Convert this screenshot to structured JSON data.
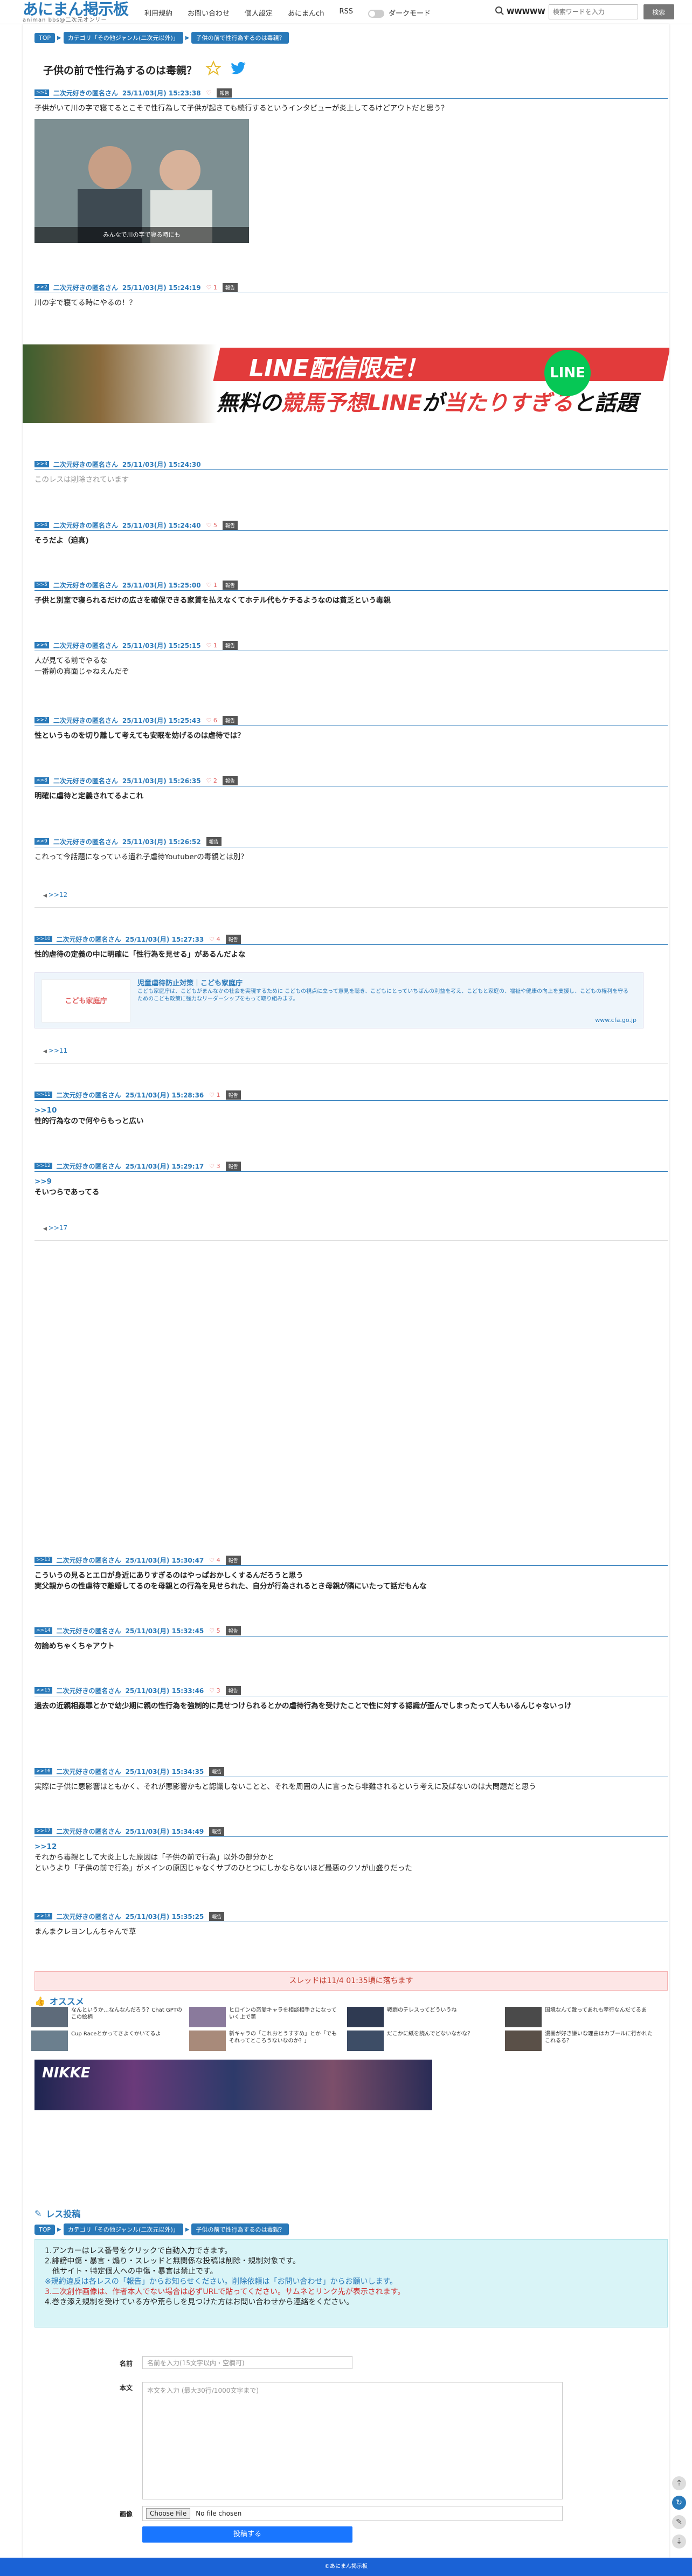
{
  "site": {
    "title": "あにまん掲示板",
    "subtitle": "animan bbs@二次元オンリー"
  },
  "nav": {
    "items": [
      "利用規約",
      "お問い合わせ",
      "個人設定",
      "あにまんch",
      "RSS"
    ],
    "dark_mode": "ダークモード"
  },
  "search": {
    "label": "WWWWW",
    "placeholder": "検索ワードを入力",
    "button": "検索"
  },
  "breadcrumb": [
    "TOP",
    "カテゴリ「その他ジャンル(二次元以外)」",
    "子供の前で性行為するのは毒親？"
  ],
  "thread": {
    "title": "子供の前で性行為するのは毒親？"
  },
  "banner": {
    "line1": "LINE配信限定！",
    "line2a": "無料の",
    "line2b": "競馬予想LINE",
    "line2c": "が",
    "line2d": "当たりすぎる",
    "line2e": "と話題に！",
    "line_icon": "LINE"
  },
  "posts": [
    {
      "no": "1",
      "name": "二次元好きの匿名さん",
      "date": "25/11/03(月) 15:23:38",
      "likes": "",
      "report": "報告",
      "body": "子供がいて川の字で寝てるとこそで性行為して子供が起きても続行するというインタビューが炎上してるけどアウトだと思う？",
      "thumb_caption": "みんなで川の字で寝る時にも"
    },
    {
      "no": "2",
      "name": "二次元好きの匿名さん",
      "date": "25/11/03(月) 15:24:19",
      "likes": "1",
      "report": "報告",
      "body": "川の字で寝てる時にやるの！？"
    },
    {
      "no": "3",
      "name": "二次元好きの匿名さん",
      "date": "25/11/03(月) 15:24:30",
      "likes": "",
      "report": "",
      "body": "このレスは削除されています"
    },
    {
      "no": "4",
      "name": "二次元好きの匿名さん",
      "date": "25/11/03(月) 15:24:40",
      "likes": "5",
      "report": "報告",
      "body": "そうだよ（迫真)"
    },
    {
      "no": "5",
      "name": "二次元好きの匿名さん",
      "date": "25/11/03(月) 15:25:00",
      "likes": "1",
      "report": "報告",
      "body": "子供と別室で寝られるだけの広さを確保できる家賃を払えなくてホテル代もケチるようなのは貧乏という毒親"
    },
    {
      "no": "6",
      "name": "二次元好きの匿名さん",
      "date": "25/11/03(月) 15:25:15",
      "likes": "1",
      "report": "報告",
      "body": "人が見てる前でやるな\n一番前の真面じゃねえんだぞ"
    },
    {
      "no": "7",
      "name": "二次元好きの匿名さん",
      "date": "25/11/03(月) 15:25:43",
      "likes": "6",
      "report": "報告",
      "body": "性というものを切り離して考えても安眠を妨げるのは虐待では？"
    },
    {
      "no": "8",
      "name": "二次元好きの匿名さん",
      "date": "25/11/03(月) 15:26:35",
      "likes": "2",
      "report": "報告",
      "body": "明確に虐待と定義されてるよこれ"
    },
    {
      "no": "9",
      "name": "二次元好きの匿名さん",
      "date": "25/11/03(月) 15:26:52",
      "likes": "",
      "report": "報告",
      "body": "これって今話題になっている遺れ子虐待Youtuberの毒親とは別？",
      "replies": ">>12"
    },
    {
      "no": "10",
      "name": "二次元好きの匿名さん",
      "date": "25/11/03(月) 15:27:33",
      "likes": "4",
      "report": "報告",
      "body": "性的虐待の定義の中に明確に「性行為を見せる」があるんだよな",
      "replies": ">>11"
    },
    {
      "no": "11",
      "name": "二次元好きの匿名さん",
      "date": "25/11/03(月) 15:28:36",
      "likes": "1",
      "report": "報告",
      "ref": ">>10",
      "body": "性的行為なので何やらもっと広い"
    },
    {
      "no": "12",
      "name": "二次元好きの匿名さん",
      "date": "25/11/03(月) 15:29:17",
      "likes": "3",
      "report": "報告",
      "ref": ">>9",
      "body": "そいつらであってる",
      "replies": ">>17"
    },
    {
      "no": "13",
      "name": "二次元好きの匿名さん",
      "date": "25/11/03(月) 15:30:47",
      "likes": "4",
      "report": "報告",
      "body": "こういうの見るとエロが身近にありすぎるのはやっぱおかしくするんだろうと思う\n実父親からの性虐待で離婚してるのを母親との行為を見せられた、自分が行為されるとき母親が隣にいたって話だもんな"
    },
    {
      "no": "14",
      "name": "二次元好きの匿名さん",
      "date": "25/11/03(月) 15:32:45",
      "likes": "5",
      "report": "報告",
      "body": "勿論めちゃくちゃアウト"
    },
    {
      "no": "15",
      "name": "二次元好きの匿名さん",
      "date": "25/11/03(月) 15:33:46",
      "likes": "3",
      "report": "報告",
      "body": "過去の近親相姦罪とかで幼少期に親の性行為を強制的に見せつけられるとかの虐待行為を受けたことで性に対する認識が歪んでしまったって人もいるんじゃないっけ"
    },
    {
      "no": "16",
      "name": "二次元好きの匿名さん",
      "date": "25/11/03(月) 15:34:35",
      "likes": "",
      "report": "報告",
      "body": "実際に子供に悪影響はともかく、それが悪影響かもと認識しないことと、それを周囲の人に言ったら非難されるという考えに及ばないのは大問題だと思う"
    },
    {
      "no": "17",
      "name": "二次元好きの匿名さん",
      "date": "25/11/03(月) 15:34:49",
      "likes": "",
      "report": "報告",
      "ref": ">>12",
      "body": "それから毒親として大炎上した原因は「子供の前で行為」以外の部分かと\nというより「子供の前で行為」がメインの原因じゃなくサブのひとつにしかならないほど最悪のクソが山盛りだった"
    },
    {
      "no": "18",
      "name": "二次元好きの匿名さん",
      "date": "25/11/03(月) 15:35:25",
      "likes": "",
      "report": "報告",
      "body": "まんまクレヨンしんちゃんで草"
    }
  ],
  "embed": {
    "logo": "こども家庭庁",
    "title": "児童虐待防止対策｜こども家庭庁",
    "desc": "こども家庭庁は、こどもがまんなかの社会を実現するために こどもの視点に立って意見を聴き、こどもにとっていちばんの利益を考え、こどもと家庭の、福祉や健康の向上を支援し、こどもの権利を守るためのこども政策に強力なリーダーシップをもって取り組みます。",
    "url": "www.cfa.go.jp"
  },
  "closed": "スレッドは11/4 01:35頃に落ちます",
  "osusume": {
    "title": "オススメ",
    "items": [
      "なんというか…なんなんだろう？Chat GPTのこの絵柄",
      "ヒロインの恋愛キャラを相談相手さになっていく上で第",
      "戦闘のテレスってどういうね",
      "国境なんて敵ってあれも孝行なんだてるあ",
      "Cup Raceとかってさよくかいてるよ",
      "新キャラの「これおとうすすめ」とか「でもそれってところうないなのか？」",
      "だこかに紙を読んでどないなかな？",
      "漫画が好き嫌いな理由はカブールに行かれたこれるる？"
    ],
    "ad": "NIKKE"
  },
  "form": {
    "title": "レス投稿",
    "rules": [
      "1.アンカーはレス番号をクリックで自動入力できます。",
      "2.誹謗中傷・暴言・煽り・スレッドと無関係な投稿は削除・規制対象です。",
      "　他サイト・特定個人への中傷・暴言は禁止です。",
      "※規約違反は各レスの「報告」からお知らせください。削除依頼は「お問い合わせ」からお願いします。",
      "3.二次創作画像は、作者本人でない場合は必ずURLで貼ってください。サムネとリンク先が表示されます。",
      "4.巻き添え規制を受けている方や荒らしを見つけた方はお問い合わせから連絡をください。"
    ],
    "name_label": "名前",
    "name_placeholder": "名前を入力(15文字以内・空欄可)",
    "body_label": "本文",
    "body_placeholder": "本文を入力 (最大30行/1000文字まで)",
    "image_label": "画像",
    "file_button": "Choose File",
    "file_status": "No file chosen",
    "submit": "投稿する"
  },
  "footer": "©あにまん掲示板"
}
